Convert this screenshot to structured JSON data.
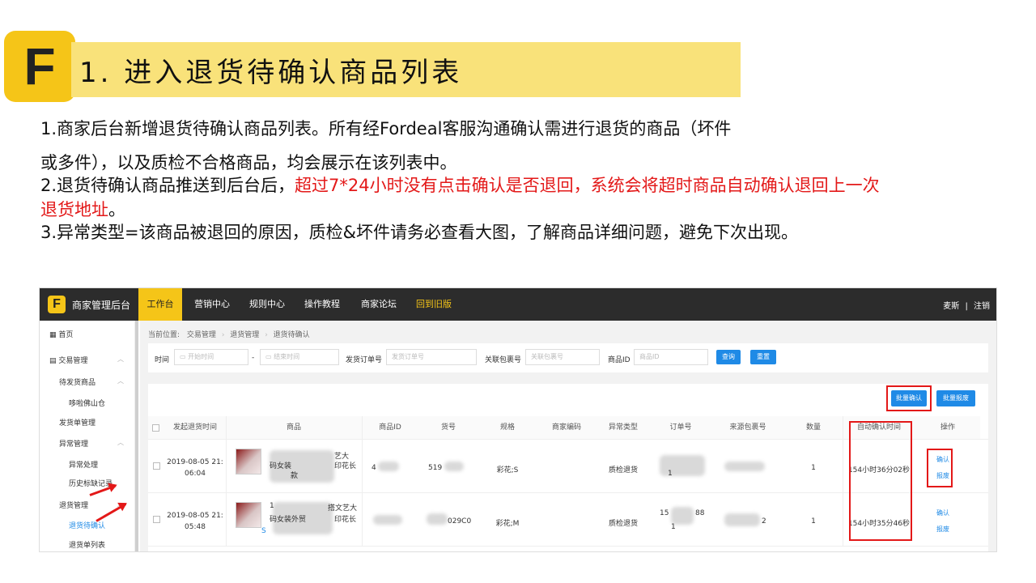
{
  "title": {
    "logo": "F",
    "text": "1. 进入退货待确认商品列表"
  },
  "body": {
    "p1": "1.商家后台新增退货待确认商品列表。所有经Fordeal客服沟通确认需进行退货的商品（坏件",
    "p1b": "或多件），以及质检不合格商品，均会展示在该列表中。",
    "p2a": "2.退货待确认商品推送到后台后，",
    "p2red1": "超过7*24小时没有点击确认是否退回，系统会将超时商品自动确认退回上一次",
    "p2red2": "退货地址",
    "p2end": "。",
    "p3": "3.异常类型=该商品被退回的原因，质检&坏件请务必查看大图，了解商品详细问题，避免下次出现。"
  },
  "colors": {
    "accent": "#f5c518",
    "title_bg": "#f9e27a",
    "emphasis": "#e31818",
    "link": "#1f8ae6",
    "nav_bg": "#2c2c2c"
  },
  "app": {
    "logo": "F",
    "brand": "商家管理后台",
    "nav": [
      "工作台",
      "营销中心",
      "规则中心",
      "操作教程",
      "商家论坛",
      "回到旧版"
    ],
    "user": "麦斯",
    "separator": "|",
    "logout": "注销",
    "sidebar": {
      "home": "首页",
      "trade": "交易管理",
      "pending_ship": "待发货商品",
      "warehouse": "哆啦佛山仓",
      "ship_mgmt": "发货单管理",
      "exception_mgmt": "异常管理",
      "exception_handle": "异常处理",
      "history": "历史标缺记录",
      "return_mgmt": "退货管理",
      "return_pending": "退货待确认",
      "return_list": "退货单列表"
    },
    "breadcrumb": [
      "当前位置:",
      "交易管理",
      "退货管理",
      "退货待确认"
    ],
    "filters": {
      "time_label": "时间",
      "start_ph": "开始时间",
      "dash": "-",
      "end_ph": "结束时间",
      "ship_order_label": "发货订单号",
      "ship_order_ph": "发货订单号",
      "pkg_label": "关联包裹号",
      "pkg_ph": "关联包裹号",
      "item_label": "商品ID",
      "item_ph": "商品ID",
      "query": "查询",
      "reset": "重置"
    },
    "batch_confirm": "批量确认",
    "batch_scrap": "批量报废",
    "columns": [
      "发起退货时间",
      "商品",
      "商品ID",
      "货号",
      "规格",
      "商家编码",
      "异常类型",
      "订单号",
      "来源包裹号",
      "数量",
      "自动确认时间",
      "操作"
    ],
    "rows": [
      {
        "time1": "2019-08-05 21:",
        "time2": "06:04",
        "prod1": "艺大",
        "prod2": "码女装",
        "prod3": "印花长",
        "prod4": "款",
        "item_id": "4",
        "sku": "519",
        "spec": "彩花;S",
        "exc": "质检退货",
        "order_tail": "1",
        "qty": "1",
        "auto": "154小时36分02秒",
        "op1": "确认",
        "op2": "报废"
      },
      {
        "time1": "2019-08-05 21:",
        "time2": "05:48",
        "prod1": "1",
        "prod1b": "搭文艺大",
        "prod2": "码女装外贸",
        "prod3": "印花长",
        "prod4": "S",
        "sku": "029C0",
        "spec": "彩花;M",
        "exc": "质检退货",
        "order1": "15",
        "order2": "88",
        "order3": "1",
        "pkg": "2",
        "qty": "1",
        "auto": "154小时35分46秒",
        "op1": "确认",
        "op2": "报废"
      }
    ]
  }
}
